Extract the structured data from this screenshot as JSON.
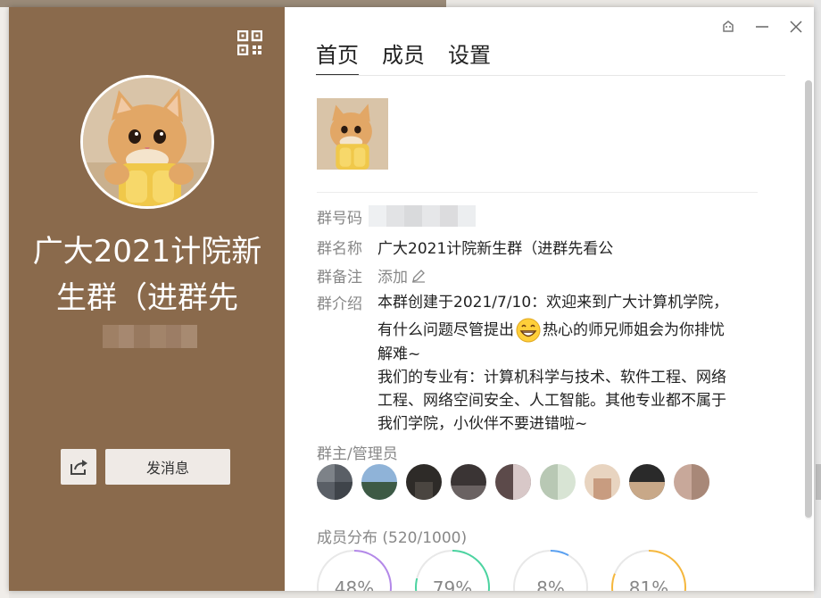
{
  "left_panel": {
    "group_name": "广大2021计院新生群（进群先",
    "send_label": "发消息",
    "icons": {
      "qr": "qr-code-icon",
      "share": "share-icon"
    }
  },
  "window_controls": {
    "skin": "skin-icon",
    "minimize": "minimize-icon",
    "close": "close-icon"
  },
  "tabs": [
    {
      "label": "首页",
      "active": true
    },
    {
      "label": "成员",
      "active": false
    },
    {
      "label": "设置",
      "active": false
    }
  ],
  "info": {
    "number_label": "群号码",
    "name_label": "群名称",
    "name_value": "广大2021计院新生群（进群先看公",
    "remark_label": "群备注",
    "remark_add": "添加",
    "intro_label": "群介绍",
    "intro_line1": "本群创建于2021/7/10：欢迎来到广大计算机学院，",
    "intro_line2a": "有什么问题尽管提出",
    "intro_line2b": "热心的师兄师姐会为你排忧",
    "intro_line3": "解难~",
    "intro_line4": "我们的专业有：计算机科学与技术、软件工程、网络",
    "intro_line5": "工程、网络空间安全、人工智能。其他专业都不属于",
    "intro_line6": "我们学院，小伙伴不要进错啦~"
  },
  "admins": {
    "label": "群主/管理员",
    "count": 9
  },
  "distribution": {
    "label": "成员分布 (520/1000)",
    "stats": [
      {
        "value": "48%",
        "fraction": 0.48,
        "color": "#b388e8"
      },
      {
        "value": "79%",
        "fraction": 0.79,
        "color": "#4cd3a0"
      },
      {
        "value": "8%",
        "fraction": 0.08,
        "color": "#5aa0f0"
      },
      {
        "value": "81%",
        "fraction": 0.81,
        "color": "#f5b73d"
      }
    ]
  },
  "colors": {
    "left_bg": "#8a6a4c",
    "button_bg": "#efeae6"
  }
}
